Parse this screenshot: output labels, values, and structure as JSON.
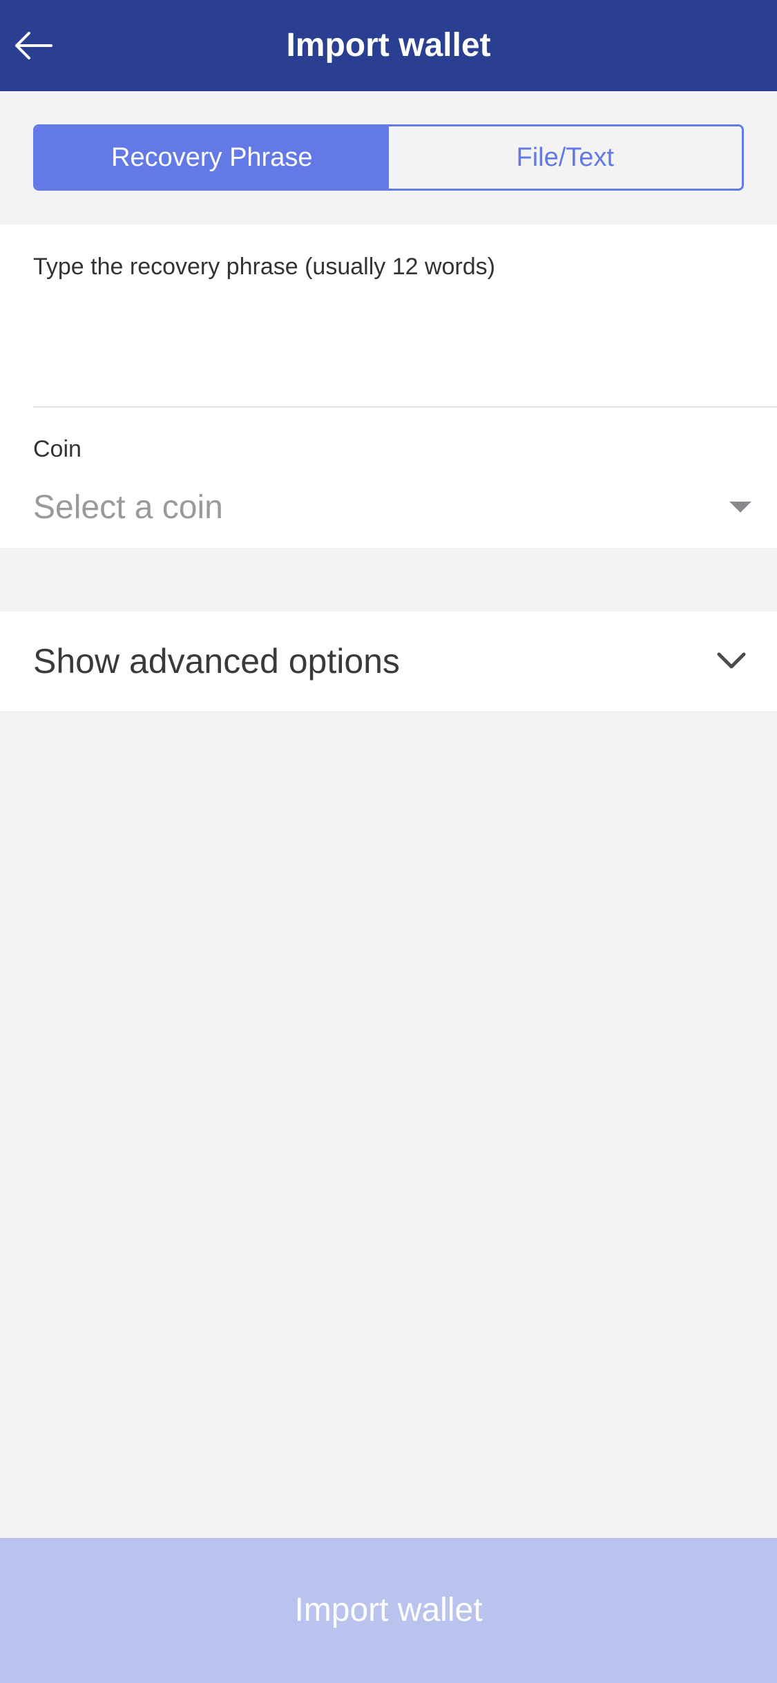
{
  "header": {
    "title": "Import wallet",
    "back_icon": "arrow-left-icon",
    "background_color": "#2a3f91"
  },
  "tabs": [
    {
      "label": "Recovery Phrase",
      "selected": true
    },
    {
      "label": "File/Text",
      "selected": false
    }
  ],
  "form": {
    "phrase_placeholder": "Type the recovery phrase (usually 12 words)",
    "coin_label": "Coin",
    "coin_placeholder": "Select a coin",
    "coin_dropdown_icon": "caret-down-icon"
  },
  "advanced": {
    "label": "Show advanced options",
    "icon": "chevron-down-icon"
  },
  "footer": {
    "import_label": "Import wallet",
    "accent_color": "#6379e6"
  }
}
